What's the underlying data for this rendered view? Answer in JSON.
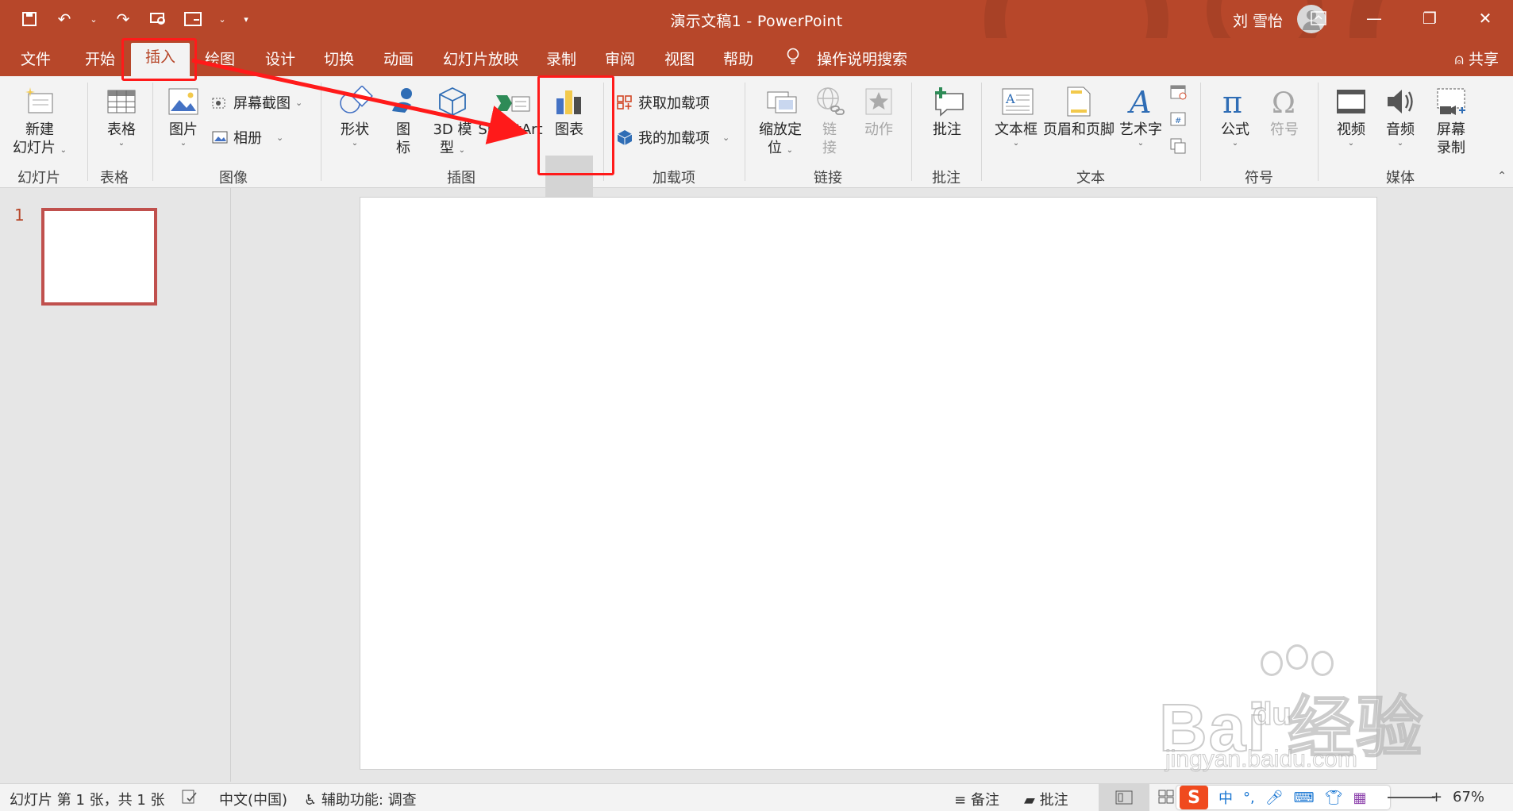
{
  "window": {
    "title": "演示文稿1  -  PowerPoint",
    "user": "刘 雪怡",
    "controls": [
      "restore-ribbon",
      "minimize",
      "restore",
      "close"
    ]
  },
  "tabs": [
    "文件",
    "开始",
    "插入",
    "绘图",
    "设计",
    "切换",
    "动画",
    "幻灯片放映",
    "录制",
    "审阅",
    "视图",
    "帮助"
  ],
  "active_tab": "插入",
  "search": "操作说明搜索",
  "share": "共享",
  "ribbon": {
    "groups": {
      "slides": "幻灯片",
      "tables": "表格",
      "images": "图像",
      "illustrations": "插图",
      "addins": "加载项",
      "links": "链接",
      "comments": "批注",
      "text": "文本",
      "symbols": "符号",
      "media": "媒体"
    },
    "cmds": {
      "new_slide_1": "新建",
      "new_slide_2": "幻灯片",
      "table": "表格",
      "picture": "图片",
      "screenshot": "屏幕截图",
      "album": "相册",
      "shapes": "形状",
      "icons_1": "图",
      "icons_2": "标",
      "model_1": "3D 模",
      "model_2": "型",
      "smartart": "SmartArt",
      "chart": "图表",
      "get_addins": "获取加载项",
      "my_addins": "我的加载项",
      "zoom_1": "缩放定",
      "zoom_2": "位",
      "link_1": "链",
      "link_2": "接",
      "action": "动作",
      "comment": "批注",
      "textbox": "文本框",
      "header_footer": "页眉和页脚",
      "wordart": "艺术字",
      "equation": "公式",
      "symbol": "符号",
      "video": "视频",
      "audio": "音频",
      "screen_rec_1": "屏幕",
      "screen_rec_2": "录制"
    }
  },
  "slides": {
    "number": "1"
  },
  "status": {
    "slide_info": "幻灯片 第 1 张，共 1 张",
    "language": "中文(中国)",
    "accessibility": "辅助功能: 调查",
    "notes": "备注",
    "comments": "批注",
    "zoom": "67%",
    "ime": {
      "logo": "S",
      "mode": "中",
      "punct": "°,"
    }
  },
  "watermark": {
    "main": "Bai 经验",
    "du": "du",
    "sub": "jingyan.baidu.com"
  },
  "colors": {
    "accent": "#b7472a",
    "highlight": "#ff1a1a",
    "ribbon": "#f3f3f3"
  }
}
